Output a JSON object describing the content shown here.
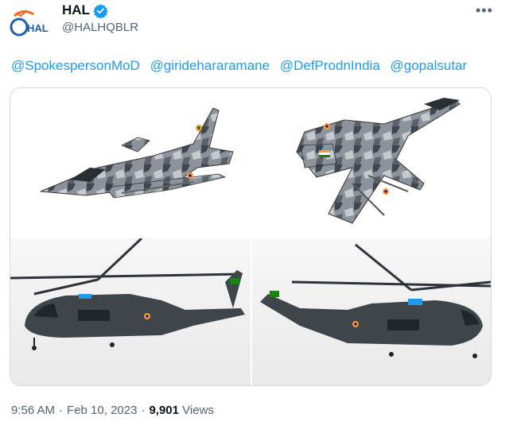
{
  "author": {
    "display_name": "HAL",
    "handle": "@HALHQBLR",
    "avatar_text": "HAL",
    "avatar_colors": {
      "bg": "#ffffff",
      "orange": "#f26a21",
      "blue": "#1f5fa8"
    },
    "verified_color": "#1d9bf0"
  },
  "tweet": {
    "mentions": [
      "@SpokespersonMoD",
      "@giridehararamane",
      "@DefProdnIndia",
      "@gopalsutar"
    ],
    "mention_color": "#1d9bf0"
  },
  "media": [
    {
      "alt": "fighter-jet-side-view"
    },
    {
      "alt": "fighter-jet-top-view"
    },
    {
      "alt": "helicopter-left-view"
    },
    {
      "alt": "helicopter-right-view"
    }
  ],
  "meta": {
    "time": "9:56 AM",
    "date": "Feb 10, 2023",
    "separator": "·",
    "views_count": "9,901",
    "views_label": "Views"
  },
  "icons": {
    "more": "more-horizontal-icon",
    "verified": "verified-badge-icon"
  }
}
